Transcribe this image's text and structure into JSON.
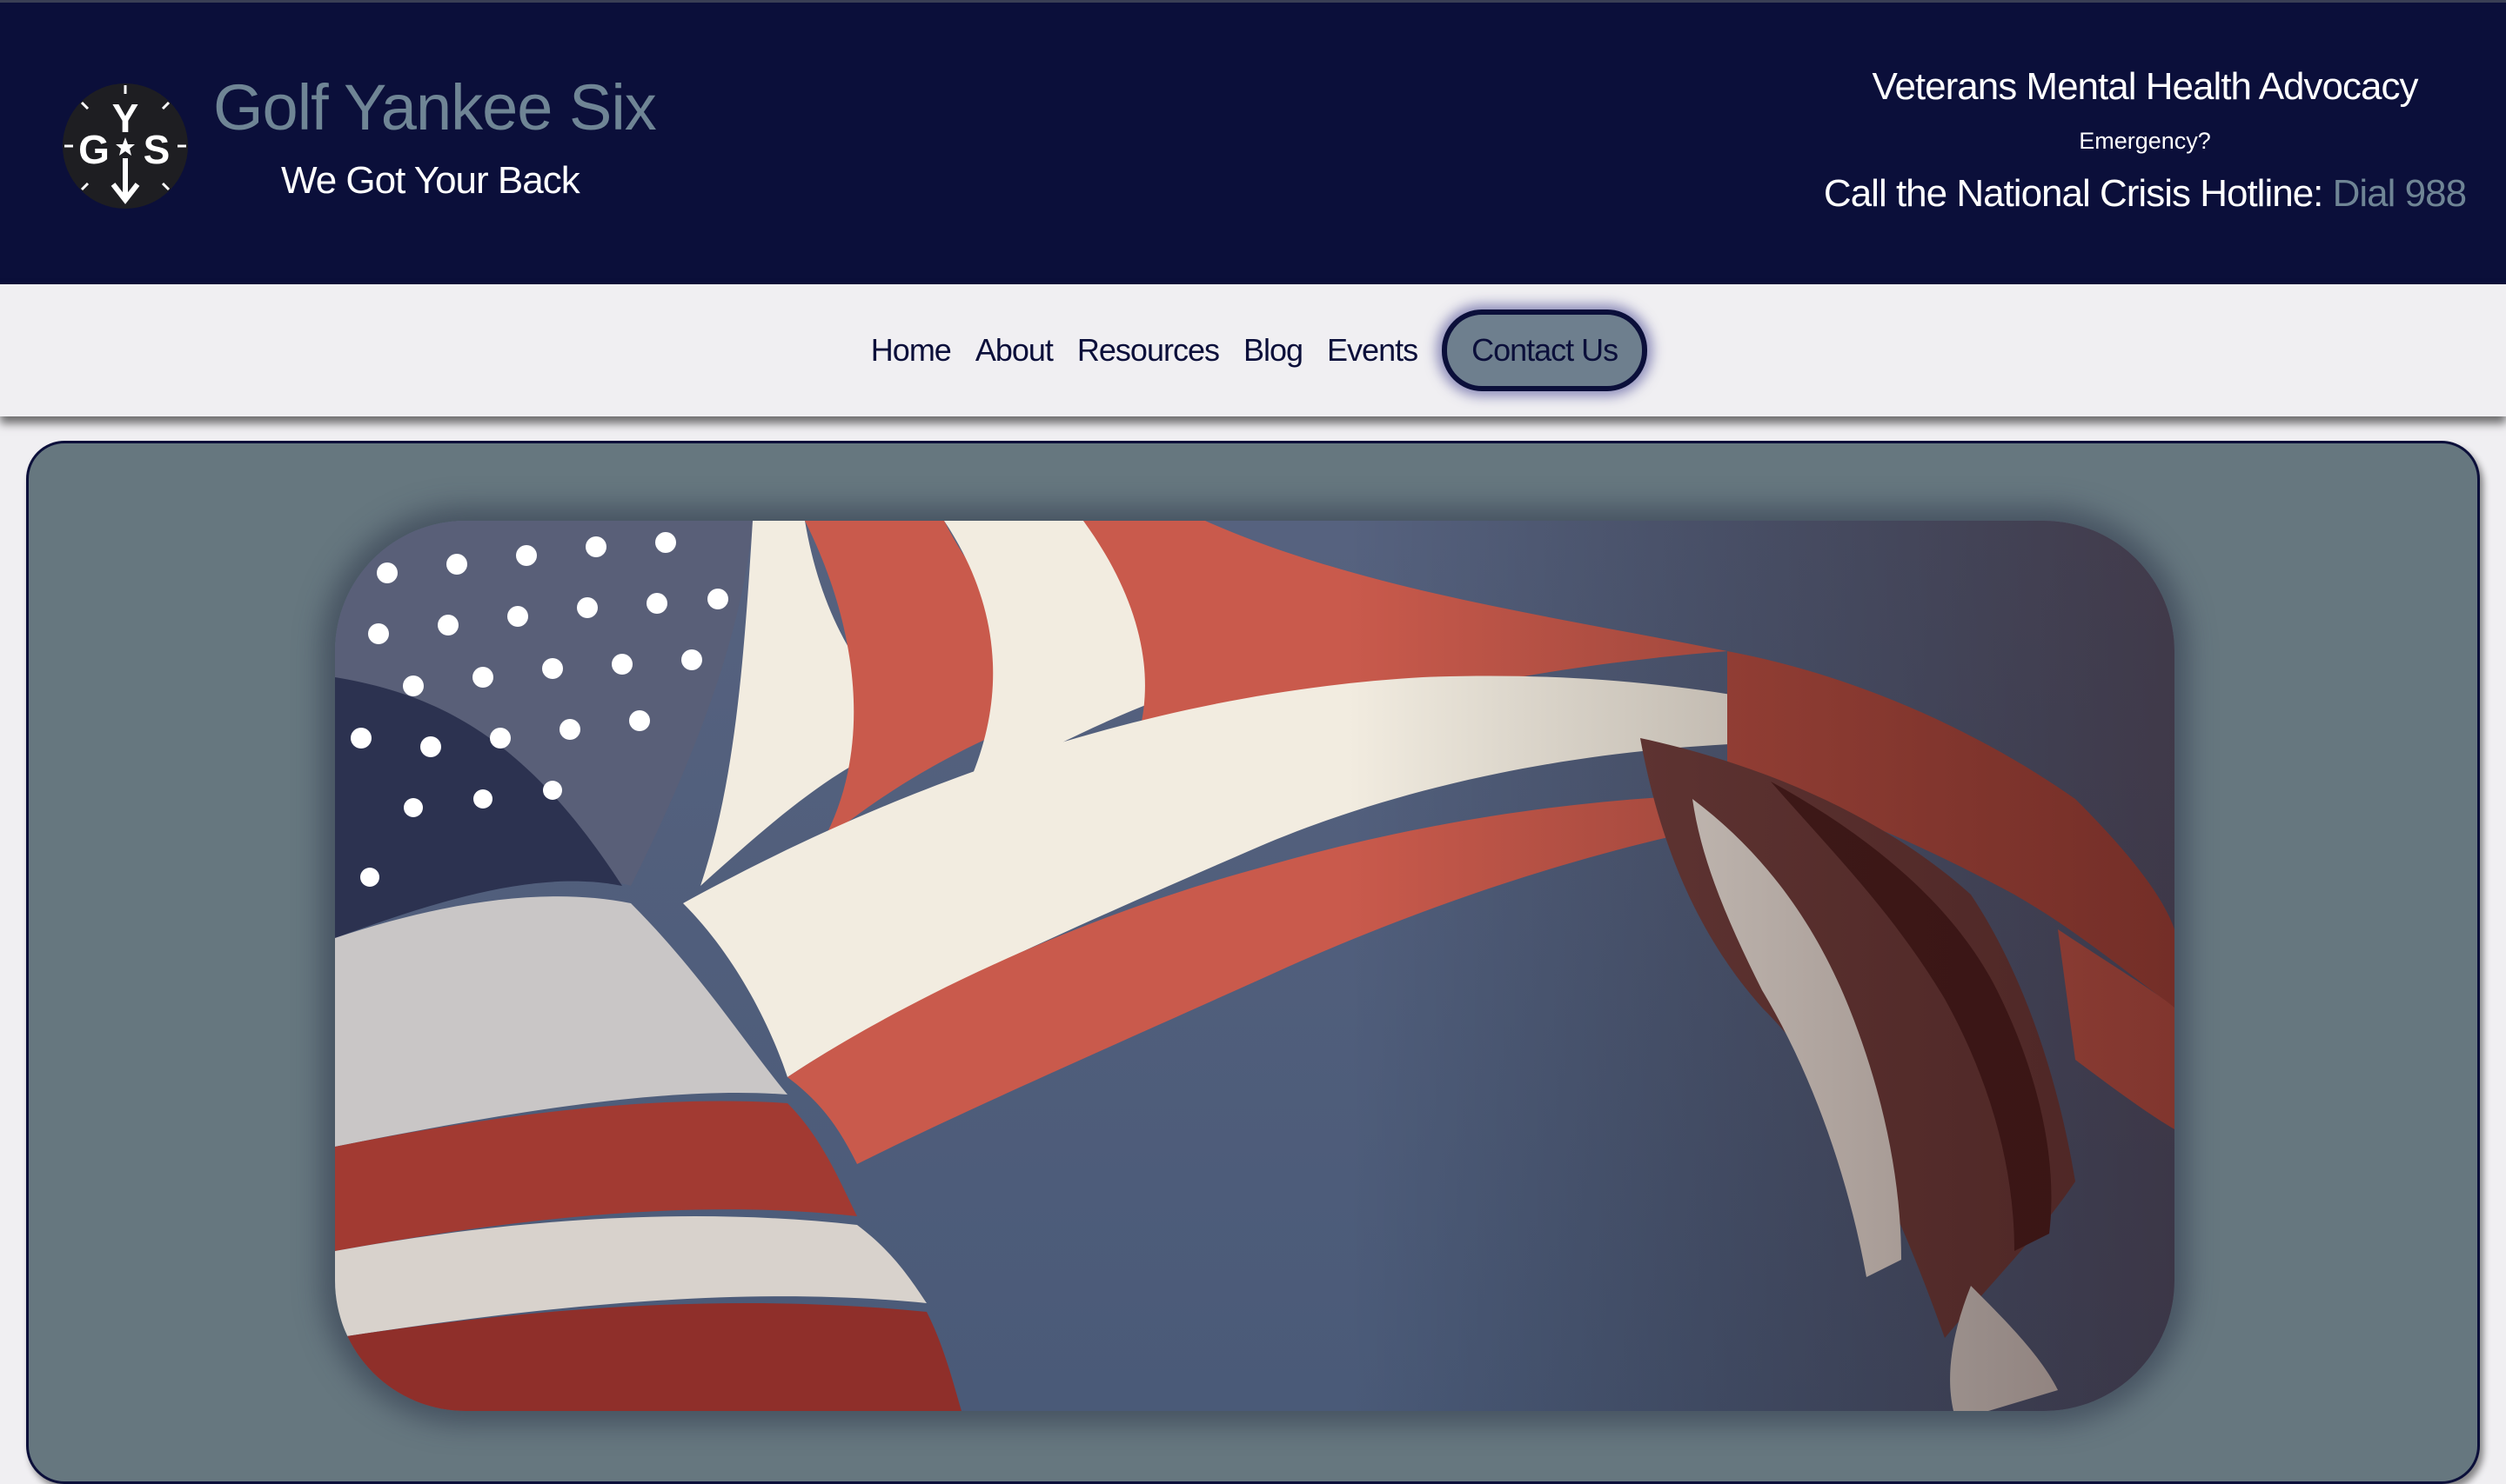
{
  "header": {
    "logo": {
      "icon": "gys-compass-logo",
      "letters": [
        "Y",
        "G",
        "S"
      ]
    },
    "brand_title": "Golf Yankee Six",
    "brand_tagline": "We Got Your Back",
    "advocacy": "Veterans Mental Health Advocacy",
    "emergency": "Emergency?",
    "hotline_prefix": "Call the National Crisis Hotline:",
    "hotline_dial": "Dial 988"
  },
  "nav": {
    "items": [
      {
        "label": "Home"
      },
      {
        "label": "About"
      },
      {
        "label": "Resources"
      },
      {
        "label": "Blog"
      },
      {
        "label": "Events"
      }
    ],
    "contact_label": "Contact Us"
  },
  "hero": {
    "image": "waving-american-flag"
  },
  "colors": {
    "header_bg": "#0b0f3a",
    "brand_title": "#6f8595",
    "nav_bg": "#f0eff2",
    "panel_bg": "#66777f",
    "sky": "#4e5d78"
  }
}
